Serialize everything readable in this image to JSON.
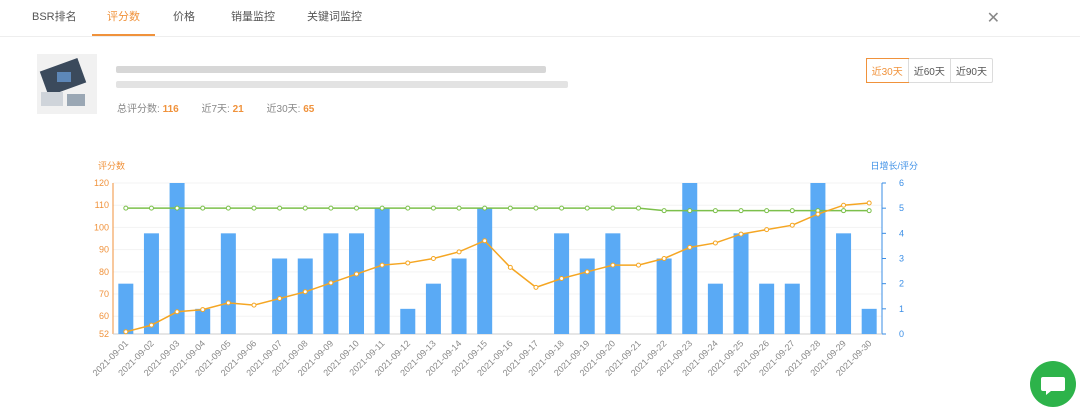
{
  "tabs": [
    {
      "label": "BSR排名",
      "active": false
    },
    {
      "label": "评分数",
      "active": true
    },
    {
      "label": "价格",
      "active": false
    },
    {
      "label": "销量监控",
      "active": false
    },
    {
      "label": "关键词监控",
      "active": false
    }
  ],
  "close_label": "✕",
  "stats": {
    "total_label": "总评分数:",
    "total_value": "116",
    "week_label": "近7天:",
    "week_value": "21",
    "month_label": "近30天:",
    "month_value": "65"
  },
  "range_buttons": [
    {
      "label": "近30天",
      "active": true
    },
    {
      "label": "近60天",
      "active": false
    },
    {
      "label": "近90天",
      "active": false
    }
  ],
  "colors": {
    "accent": "#f0923b",
    "bar": "#5aaaf5",
    "line_orange": "#f5a623",
    "line_green": "#7cc04b",
    "right_axis": "#3a8ee6",
    "chat_button": "#2db34a"
  },
  "chart_data": {
    "type": "bar",
    "ylabel_left": "评分数",
    "ylabel_right": "日增长/评分",
    "ylim_left": [
      52,
      120
    ],
    "yticks_left": [
      52,
      60,
      70,
      80,
      90,
      100,
      110,
      120
    ],
    "ylim_right": [
      0,
      6
    ],
    "yticks_right": [
      0,
      1,
      2,
      3,
      4,
      5,
      6
    ],
    "categories": [
      "2021-09-01",
      "2021-09-02",
      "2021-09-03",
      "2021-09-04",
      "2021-09-05",
      "2021-09-06",
      "2021-09-07",
      "2021-09-08",
      "2021-09-09",
      "2021-09-10",
      "2021-09-11",
      "2021-09-12",
      "2021-09-13",
      "2021-09-14",
      "2021-09-15",
      "2021-09-16",
      "2021-09-17",
      "2021-09-18",
      "2021-09-19",
      "2021-09-20",
      "2021-09-21",
      "2021-09-22",
      "2021-09-23",
      "2021-09-24",
      "2021-09-25",
      "2021-09-26",
      "2021-09-27",
      "2021-09-28",
      "2021-09-29",
      "2021-09-30"
    ],
    "series": [
      {
        "type": "bar",
        "axis": "right",
        "values": [
          2,
          4,
          6,
          1,
          4,
          0,
          3,
          3,
          4,
          4,
          5,
          1,
          2,
          3,
          5,
          0,
          0,
          4,
          3,
          4,
          0,
          3,
          6,
          2,
          4,
          2,
          2,
          6,
          4,
          1
        ]
      },
      {
        "type": "line",
        "axis": "left",
        "values": [
          53,
          56,
          62,
          63,
          66,
          65,
          68,
          71,
          75,
          79,
          83,
          84,
          86,
          89,
          94,
          82,
          73,
          77,
          80,
          83,
          83,
          86,
          91,
          93,
          97,
          99,
          101,
          106,
          110,
          111
        ]
      },
      {
        "type": "line",
        "axis": "right",
        "values": [
          5,
          5,
          5,
          5,
          5,
          5,
          5,
          5,
          5,
          5,
          5,
          5,
          5,
          5,
          5,
          5,
          5,
          5,
          5,
          5,
          5,
          4.9,
          4.9,
          4.9,
          4.9,
          4.9,
          4.9,
          4.9,
          4.9,
          4.9
        ]
      }
    ]
  }
}
